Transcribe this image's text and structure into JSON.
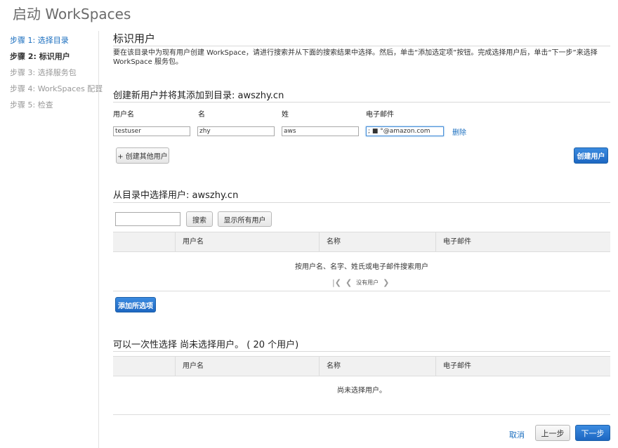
{
  "page": {
    "title": "启动 WorkSpaces"
  },
  "steps": [
    {
      "label": "步骤 1: 选择目录",
      "state": "done"
    },
    {
      "label": "步骤 2: 标识用户",
      "state": "current"
    },
    {
      "label": "步骤 3: 选择服务包",
      "state": "todo"
    },
    {
      "label": "步骤 4: WorkSpaces 配置",
      "state": "todo"
    },
    {
      "label": "步骤 5: 检查",
      "state": "todo"
    }
  ],
  "identify": {
    "title": "标识用户",
    "description": "要在该目录中为现有用户创建 WorkSpace，请进行搜索并从下面的搜索结果中选择。然后，单击“添加选定项”按钮。完成选择用户后，单击“下一步”来选择 WorkSpace 服务包。"
  },
  "create": {
    "title": "创建新用户并将其添加到目录: awszhy.cn",
    "columns": {
      "username": "用户名",
      "firstname": "名",
      "lastname": "姓",
      "email": "电子邮件"
    },
    "row": {
      "username": "testuser",
      "firstname": "zhy",
      "lastname": "aws",
      "email": "; ■ °@amazon.com"
    },
    "delete_label": "删除",
    "add_other_label": "+ 创建其他用户",
    "create_label": "创建用户"
  },
  "select": {
    "title": "从目录中选择用户: awszhy.cn",
    "search_value": "",
    "search_button": "搜索",
    "show_all_button": "显示所有用户",
    "columns": [
      "用户名",
      "名称",
      "电子邮件"
    ],
    "empty_message": "按用户名、名字、姓氏或电子邮件搜索用户",
    "pager_text": "没有用户",
    "add_selected_label": "添加所选项"
  },
  "selected": {
    "title": "可以一次性选择 尚未选择用户。 ( 20 个用户)",
    "columns": [
      "用户名",
      "名称",
      "电子邮件"
    ],
    "empty_message": "尚未选择用户。"
  },
  "footer": {
    "cancel": "取消",
    "prev": "上一步",
    "next": "下一步"
  },
  "colors": {
    "link": "#1a6ebf",
    "primary": "#1d67c2",
    "table_header": "#f1f1f1"
  }
}
